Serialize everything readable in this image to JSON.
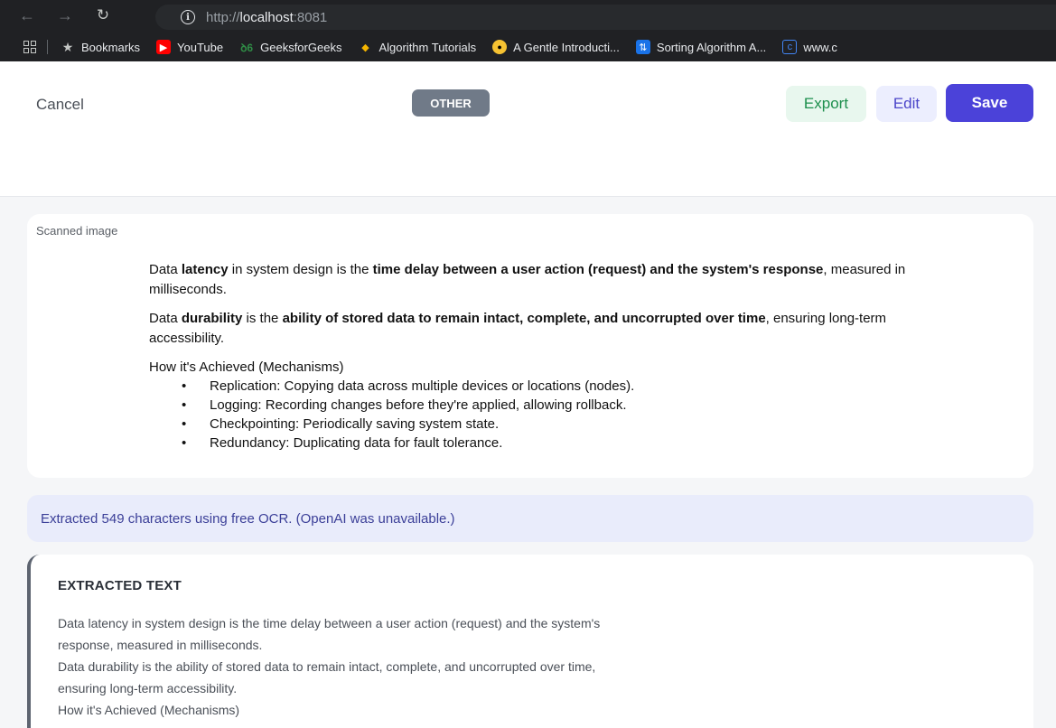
{
  "browser": {
    "url_scheme": "http://",
    "url_host": "localhost",
    "url_port": ":8081",
    "bookmarks": [
      {
        "label": "Bookmarks",
        "icon": "star-icon"
      },
      {
        "label": "YouTube",
        "icon": "youtube-icon"
      },
      {
        "label": "GeeksforGeeks",
        "icon": "gfg-icon"
      },
      {
        "label": "Algorithm Tutorials",
        "icon": "algorithm-icon"
      },
      {
        "label": "A Gentle Introducti...",
        "icon": "emoji-icon"
      },
      {
        "label": "Sorting Algorithm A...",
        "icon": "sorting-icon"
      },
      {
        "label": "www.c",
        "icon": "site-icon"
      }
    ]
  },
  "header": {
    "cancel_label": "Cancel",
    "category_badge": "OTHER",
    "export_label": "Export",
    "edit_label": "Edit",
    "save_label": "Save"
  },
  "scan": {
    "label": "Scanned image",
    "p1": {
      "a": "Data ",
      "b1": "latency",
      "c": " in system design is the ",
      "b2": "time delay between a user action (request) and the system's response",
      "d": ", measured in milliseconds."
    },
    "p2": {
      "a": "Data ",
      "b1": "durability",
      "c": " is the ",
      "b2": "ability of stored data to remain intact, complete, and uncorrupted over time",
      "d": ", ensuring long-term accessibility."
    },
    "p3": "How it's Achieved (Mechanisms)",
    "bullets": [
      "Replication: Copying data across multiple devices or locations (nodes).",
      "Logging: Recording changes before they're applied, allowing rollback.",
      "Checkpointing: Periodically saving system state.",
      "Redundancy: Duplicating data for fault tolerance."
    ]
  },
  "info": {
    "message": "Extracted 549 characters using free OCR. (OpenAI was unavailable.)"
  },
  "extracted": {
    "title": "EXTRACTED TEXT",
    "lines": [
      "Data latency in system design is the time delay between a user action (request) and the system's",
      "response, measured in milliseconds.",
      "Data durability is the ability of stored data to remain intact, complete, and uncorrupted over time,",
      "ensuring long-term accessibility.",
      "How it's Achieved (Mechanisms)"
    ]
  }
}
